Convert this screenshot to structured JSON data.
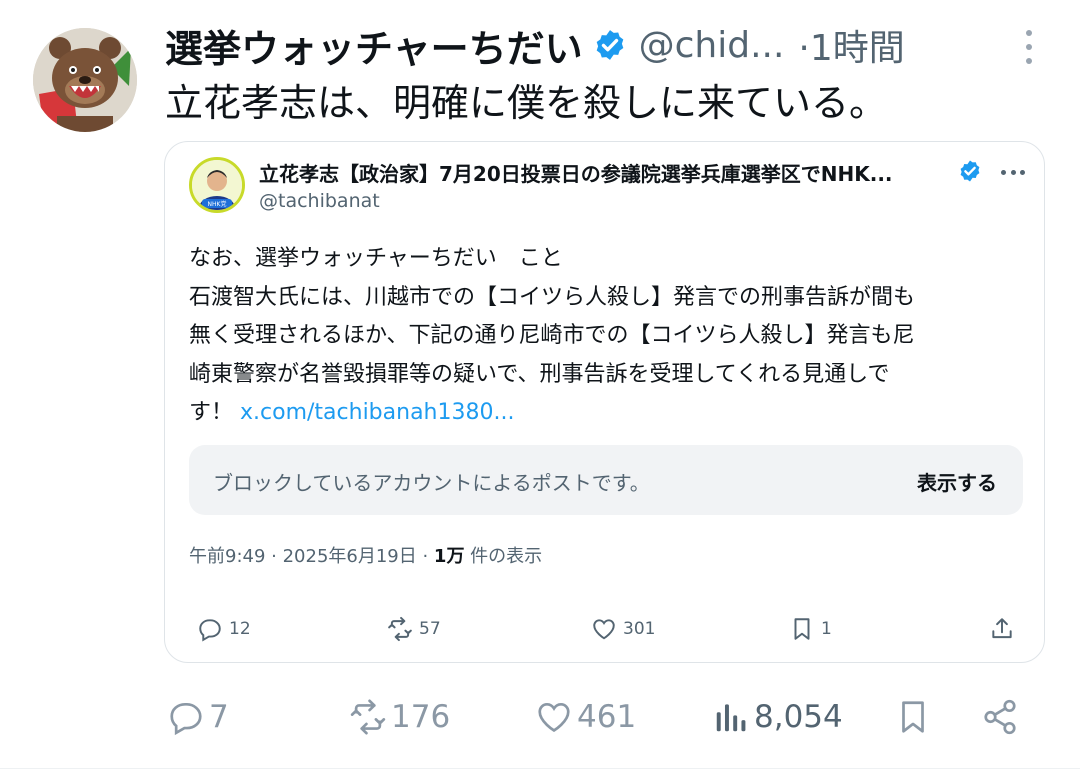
{
  "tweet": {
    "display_name": "選挙ウォッチャーちだい",
    "handle": "@chid...",
    "time": "·1時間",
    "text": "立花孝志は、明確に僕を殺しに来ている。",
    "avatar_icon": "bear-avatar-icon"
  },
  "quoted": {
    "display_name": "立花孝志【政治家】7月20日投票日の参議院選挙兵庫選挙区でNHK...",
    "handle": "@tachibanat",
    "avatar_badge": "NHK党",
    "lines": [
      "なお、選挙ウォッチャーちだい　こと",
      "石渡智大氏には、川越市での【コイツら人殺し】発言での刑事告訴が間も",
      "無く受理されるほか、下記の通り尼崎市での【コイツら人殺し】発言も尼",
      "崎東警察が名誉毀損罪等の疑いで、刑事告訴を受理してくれる見通しで"
    ],
    "last_line_prefix": "す！",
    "link": "x.com/tachibanah1380...",
    "blocked_message": "ブロックしているアカウントによるポストです。",
    "show_button": "表示する",
    "meta_time": "午前9:49 · 2025年6月19日 · ",
    "views_count": "1万",
    "views_label": " 件の表示",
    "stats": {
      "replies": "12",
      "reposts": "57",
      "likes": "301",
      "bookmarks": "1"
    }
  },
  "actions": {
    "replies": "7",
    "reposts": "176",
    "likes": "461",
    "views": "8,054"
  },
  "colors": {
    "link": "#1d9bf0",
    "verified": "#1d9bf0",
    "secondary_text": "#536471"
  }
}
